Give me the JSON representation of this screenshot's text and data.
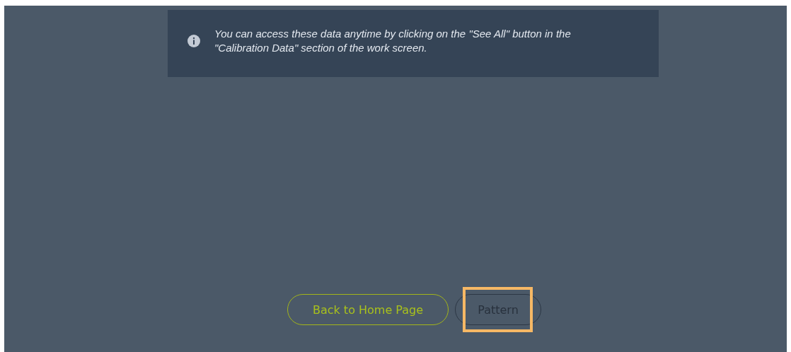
{
  "info_message": {
    "text": "You can access these data anytime by clicking on the \"See All\" button in the \"Calibration Data\" section of the work screen."
  },
  "buttons": [
    {
      "label": "Back to Home Page",
      "kind": "primary",
      "highlighted": false
    },
    {
      "label": "Pattern",
      "kind": "secondary",
      "highlighted": true
    }
  ]
}
